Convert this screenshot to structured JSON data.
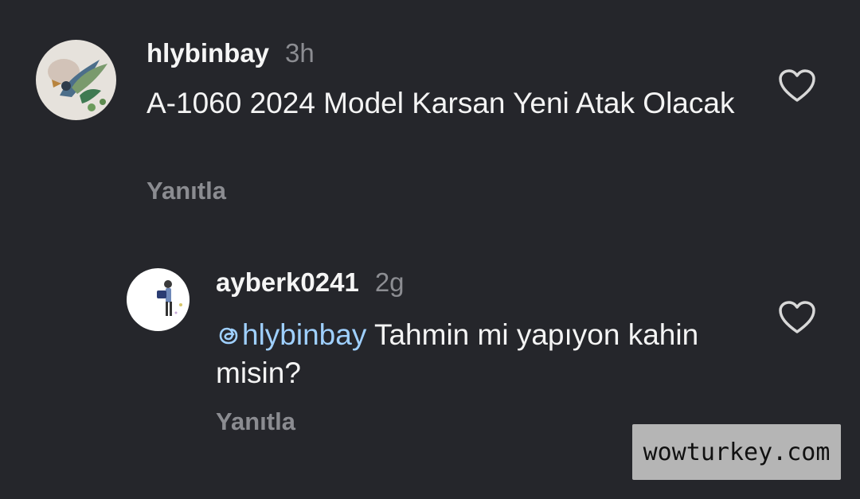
{
  "comments": [
    {
      "username": "hlybinbay",
      "time": "3h",
      "text": "A-1060 2024 Model Karsan Yeni Atak Olacak",
      "reply_label": "Yanıtla",
      "avatar_icon": "bird-painting-avatar",
      "like_icon": "heart-outline-icon"
    },
    {
      "username": "ayberk0241",
      "time": "2g",
      "mention": "hlybinbay",
      "text": "Tahmin mi yapıyon kahin misin?",
      "reply_label": "Yanıtla",
      "avatar_icon": "person-illustration-avatar",
      "like_icon": "heart-outline-icon"
    }
  ],
  "watermark": "wowturkey.com",
  "colors": {
    "background": "#25262b",
    "mention": "#9fd0ff",
    "muted": "#8b8c91"
  }
}
